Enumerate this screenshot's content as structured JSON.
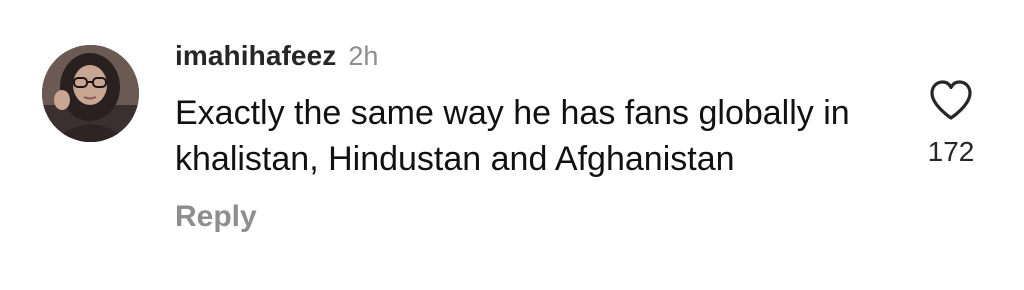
{
  "comment": {
    "username": "imahihafeez",
    "timestamp": "2h",
    "text": "Exactly the same way he has fans globally in khalistan, Hindustan and Afghanistan",
    "reply_label": "Reply",
    "like_count": "172",
    "like_icon": "heart-outline-icon",
    "avatar_icon": "user-avatar"
  }
}
